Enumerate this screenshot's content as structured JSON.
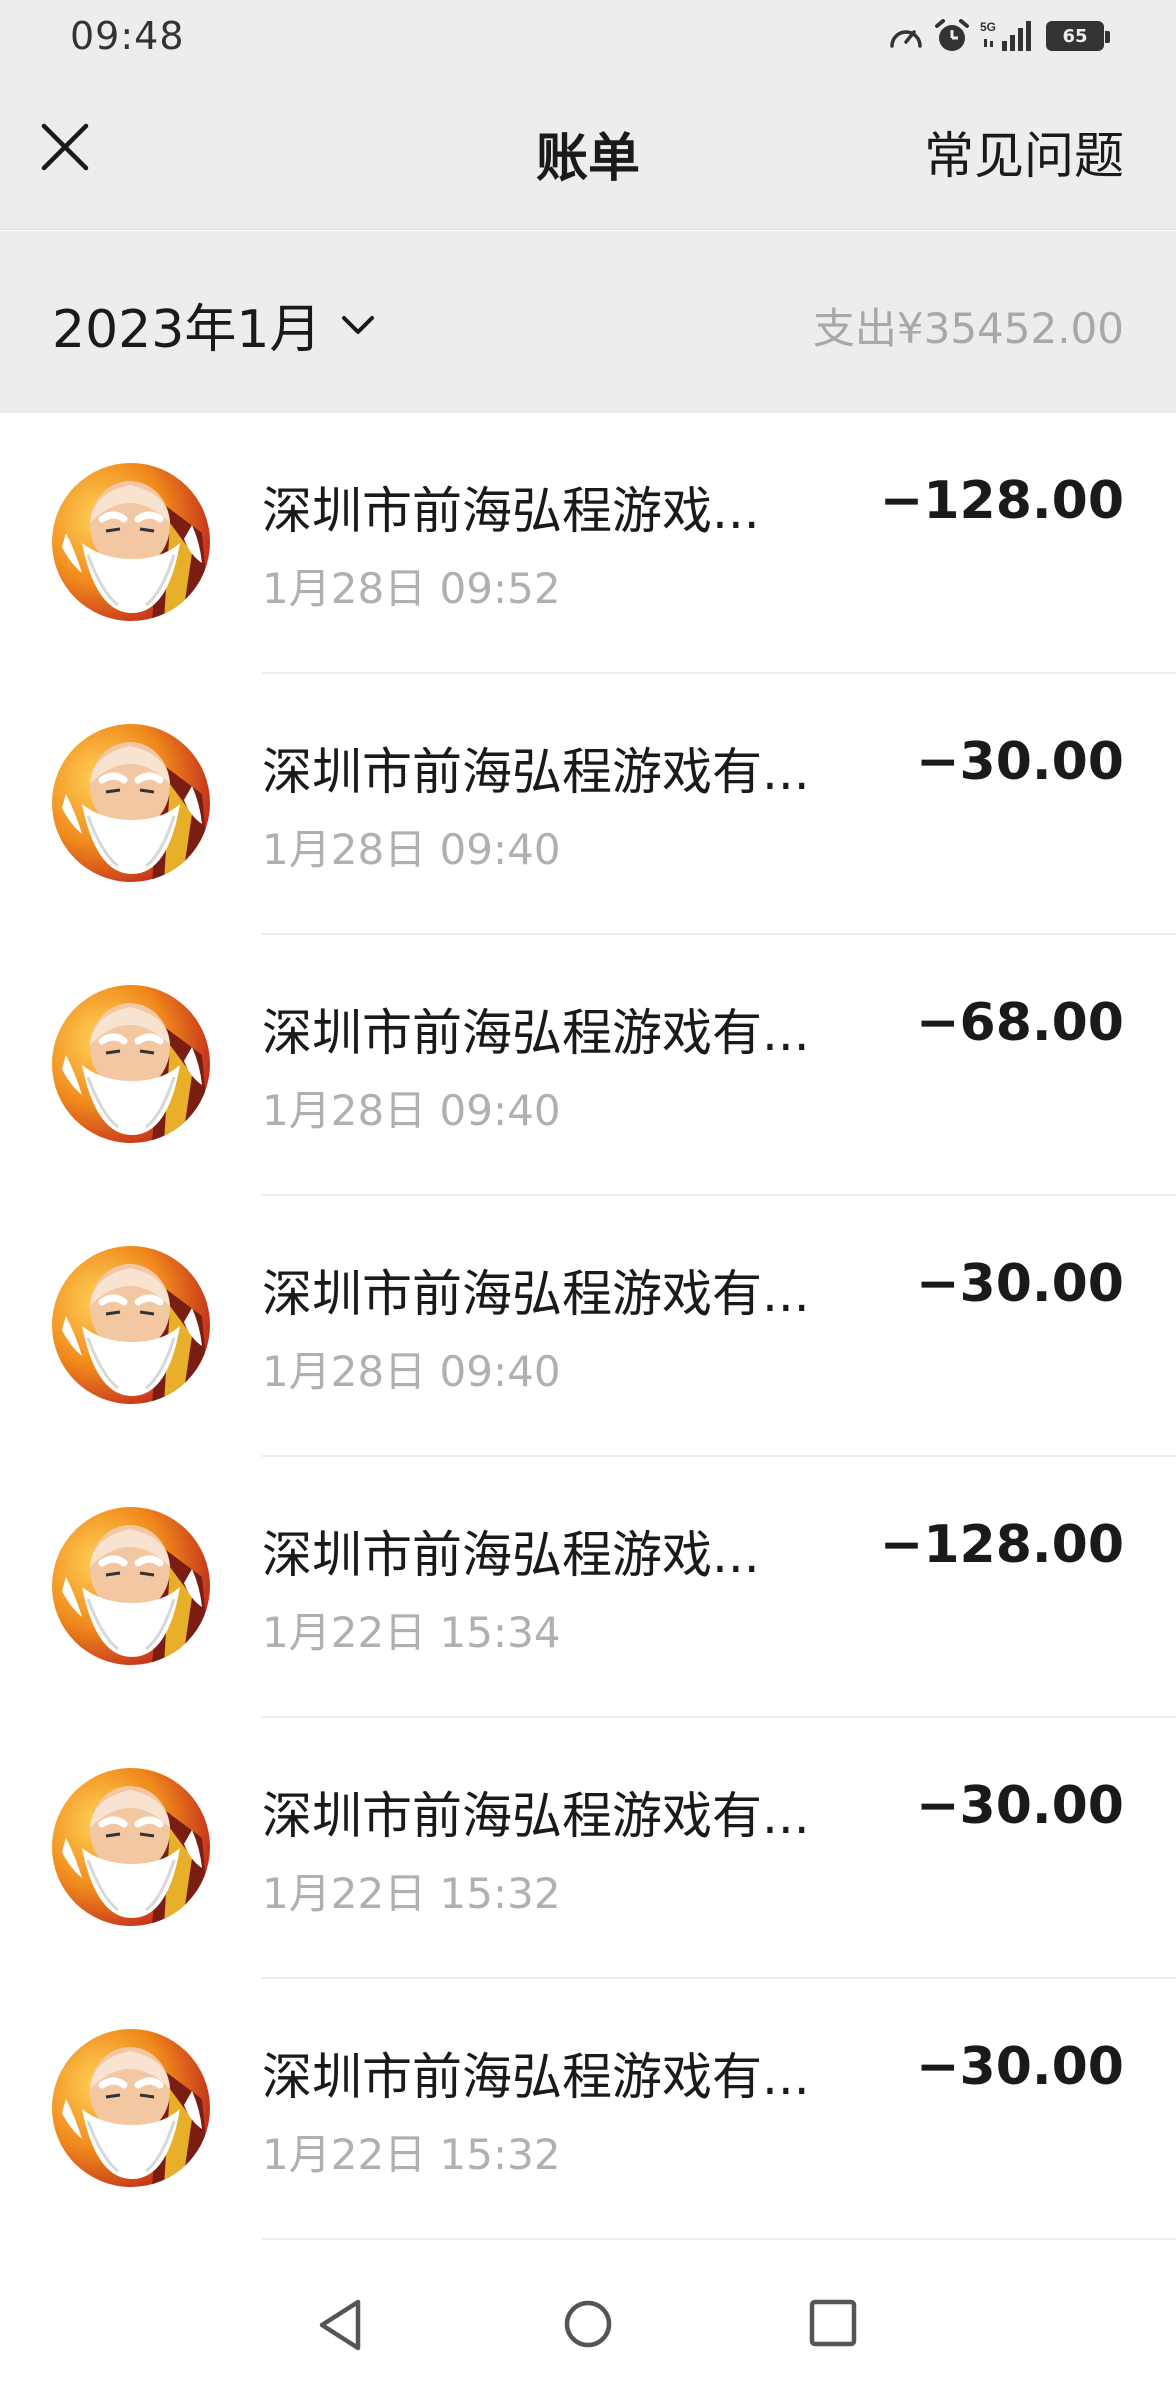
{
  "status_bar": {
    "time": "09:48",
    "signal_label": "5G",
    "battery": "65",
    "icons": [
      "speedometer-icon",
      "alarm-icon",
      "signal-icon",
      "battery-icon"
    ]
  },
  "nav": {
    "title": "账单",
    "faq_label": "常见问题",
    "close_icon": "close-icon"
  },
  "month_bar": {
    "month": "2023年1月",
    "total": "支出¥35452.00"
  },
  "transactions": [
    {
      "title": "深圳市前海弘程游戏...",
      "time": "1月28日 09:52",
      "amount": "−128.00"
    },
    {
      "title": "深圳市前海弘程游戏有...",
      "time": "1月28日 09:40",
      "amount": "−30.00"
    },
    {
      "title": "深圳市前海弘程游戏有...",
      "time": "1月28日 09:40",
      "amount": "−68.00"
    },
    {
      "title": "深圳市前海弘程游戏有...",
      "time": "1月28日 09:40",
      "amount": "−30.00"
    },
    {
      "title": "深圳市前海弘程游戏...",
      "time": "1月22日 15:34",
      "amount": "−128.00"
    },
    {
      "title": "深圳市前海弘程游戏有...",
      "time": "1月22日 15:32",
      "amount": "−30.00"
    },
    {
      "title": "深圳市前海弘程游戏有...",
      "time": "1月22日 15:32",
      "amount": "−30.00"
    }
  ],
  "colors": {
    "header_bg": "#ededed",
    "muted_text": "#a8a8a8",
    "avatar_orange": "#f08a1c",
    "avatar_red": "#c0281c"
  }
}
